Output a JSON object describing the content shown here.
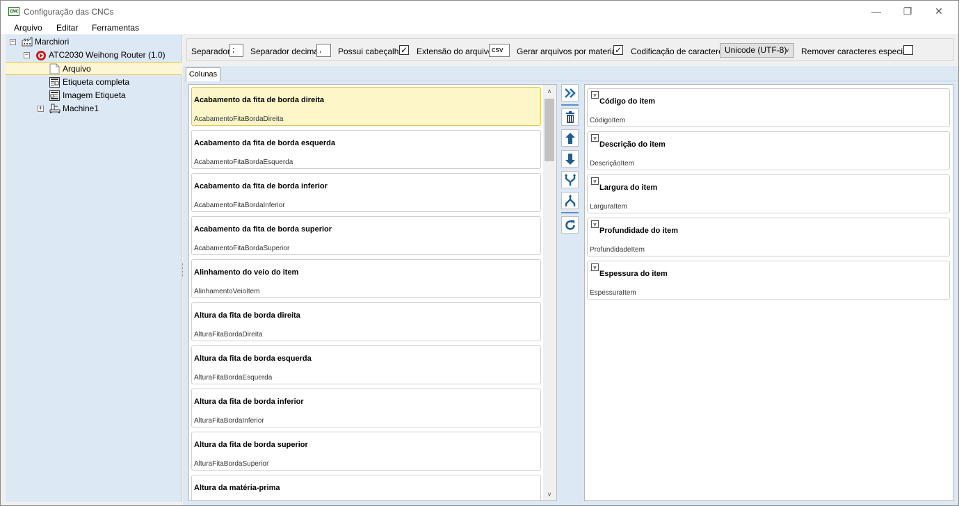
{
  "window": {
    "title": "Configuração das CNCs",
    "app_icon_text": "CNC",
    "controls": {
      "minimize": "—",
      "maximize": "❐",
      "close": "✕"
    }
  },
  "menu": {
    "items": [
      "Arquivo",
      "Editar",
      "Ferramentas"
    ]
  },
  "tree": {
    "root": {
      "label": "Marchiori",
      "icon": "factory-icon",
      "expander": "−"
    },
    "machine": {
      "label": "ATC2030 Weihong Router (1.0)",
      "icon": "router-logo-icon",
      "expander": "−"
    },
    "children": [
      {
        "label": "Arquivo",
        "icon": "file-icon",
        "selected": true
      },
      {
        "label": "Etiqueta completa",
        "icon": "label-icon",
        "selected": false
      },
      {
        "label": "Imagem Etiqueta",
        "icon": "label-image-icon",
        "selected": false
      }
    ],
    "machine1": {
      "label": "Machine1",
      "icon": "cnc-machine-icon",
      "expander": "+"
    }
  },
  "options": {
    "separator_label": "Separador",
    "separator_value": ";",
    "decimal_label": "Separador decimal",
    "decimal_value": ",",
    "header_label": "Possui cabeçalho",
    "header_checked": true,
    "extension_label": "Extensão do arquivo",
    "extension_value": "csv",
    "per_material_label": "Gerar arquivos por material",
    "per_material_checked": true,
    "encoding_label": "Codificação de caracteres",
    "encoding_value": "Unicode (UTF-8)",
    "remove_special_label": "Remover caracteres especiais",
    "remove_special_checked": false,
    "check_mark": "✓"
  },
  "tabs": [
    {
      "label": "Colunas",
      "active": true
    }
  ],
  "available_columns": [
    {
      "title": "Acabamento da fita de borda direita",
      "key": "AcabamentoFitaBordaDireita",
      "selected": true
    },
    {
      "title": "Acabamento da fita de borda esquerda",
      "key": "AcabamentoFitaBordaEsquerda"
    },
    {
      "title": "Acabamento da fita de borda inferior",
      "key": "AcabamentoFitaBordaInferior"
    },
    {
      "title": "Acabamento da fita de borda superior",
      "key": "AcabamentoFitaBordaSuperior"
    },
    {
      "title": "Alinhamento do veio do item",
      "key": "AlinhamentoVeioItem"
    },
    {
      "title": "Altura da fita de borda direita",
      "key": "AlturaFitaBordaDireita"
    },
    {
      "title": "Altura da fita de borda esquerda",
      "key": "AlturaFitaBordaEsquerda"
    },
    {
      "title": "Altura da fita de borda inferior",
      "key": "AlturaFitaBordaInferior"
    },
    {
      "title": "Altura da fita de borda superior",
      "key": "AlturaFitaBordaSuperior"
    },
    {
      "title": "Altura da matéria-prima",
      "key": ""
    }
  ],
  "selected_columns": [
    {
      "title": "Código do item",
      "key": "CódigoItem"
    },
    {
      "title": "Descrição do item",
      "key": "DescriçãoItem"
    },
    {
      "title": "Largura do item",
      "key": "LarguraItem"
    },
    {
      "title": "Profundidade do item",
      "key": "ProfundidadeItem"
    },
    {
      "title": "Espessura do item",
      "key": "EspessuraItem"
    }
  ],
  "actions": [
    "add-column",
    "delete-column",
    "move-up",
    "move-down",
    "merge-columns",
    "split-column",
    "refresh"
  ],
  "colors": {
    "accent": "#2a6bb5",
    "tree_bg": "#dde8f5",
    "selection": "#fcf6c8"
  }
}
